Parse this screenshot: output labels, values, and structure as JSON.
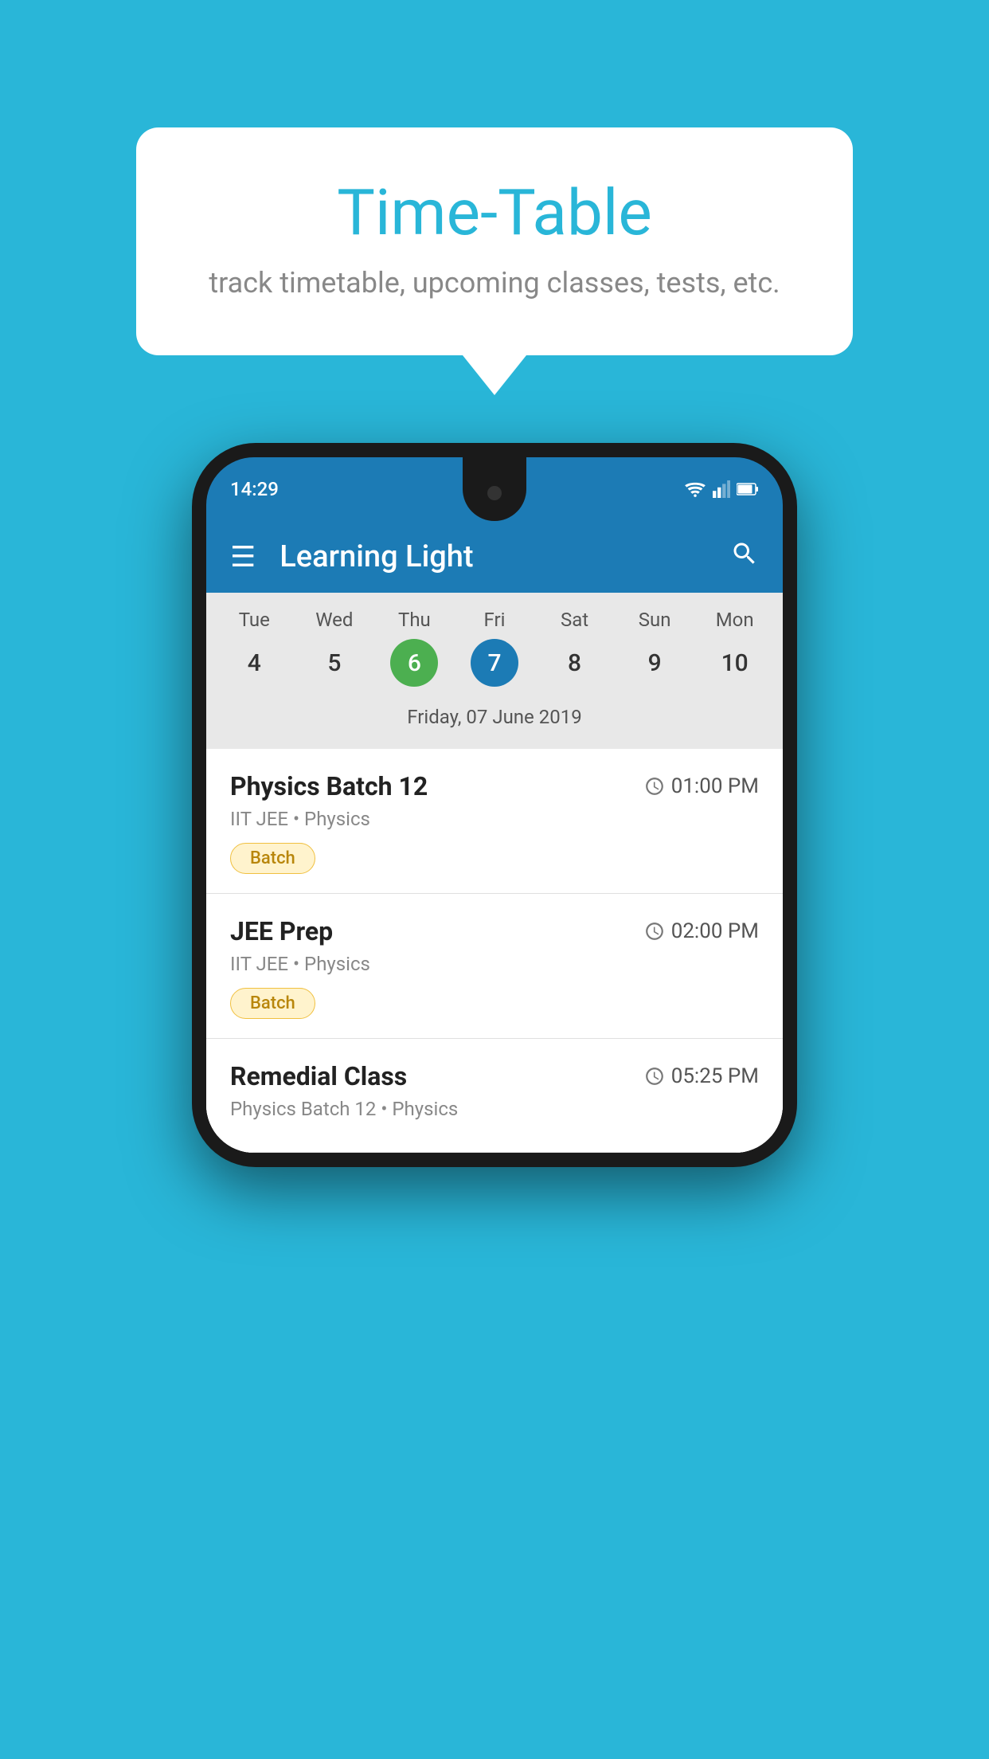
{
  "page": {
    "background_color": "#29b6d8"
  },
  "speech_bubble": {
    "title": "Time-Table",
    "subtitle": "track timetable, upcoming classes, tests, etc."
  },
  "phone": {
    "status_bar": {
      "time": "14:29"
    },
    "app_bar": {
      "title": "Learning Light",
      "menu_icon": "☰",
      "search_icon": "🔍"
    },
    "calendar": {
      "days": [
        {
          "label": "Tue",
          "num": "4",
          "state": "normal"
        },
        {
          "label": "Wed",
          "num": "5",
          "state": "normal"
        },
        {
          "label": "Thu",
          "num": "6",
          "state": "today"
        },
        {
          "label": "Fri",
          "num": "7",
          "state": "selected"
        },
        {
          "label": "Sat",
          "num": "8",
          "state": "normal"
        },
        {
          "label": "Sun",
          "num": "9",
          "state": "normal"
        },
        {
          "label": "Mon",
          "num": "10",
          "state": "normal"
        }
      ],
      "selected_date_label": "Friday, 07 June 2019"
    },
    "schedule": [
      {
        "title": "Physics Batch 12",
        "time": "01:00 PM",
        "meta": "IIT JEE • Physics",
        "badge": "Batch"
      },
      {
        "title": "JEE Prep",
        "time": "02:00 PM",
        "meta": "IIT JEE • Physics",
        "badge": "Batch"
      },
      {
        "title": "Remedial Class",
        "time": "05:25 PM",
        "meta": "Physics Batch 12 • Physics",
        "badge": ""
      }
    ]
  }
}
